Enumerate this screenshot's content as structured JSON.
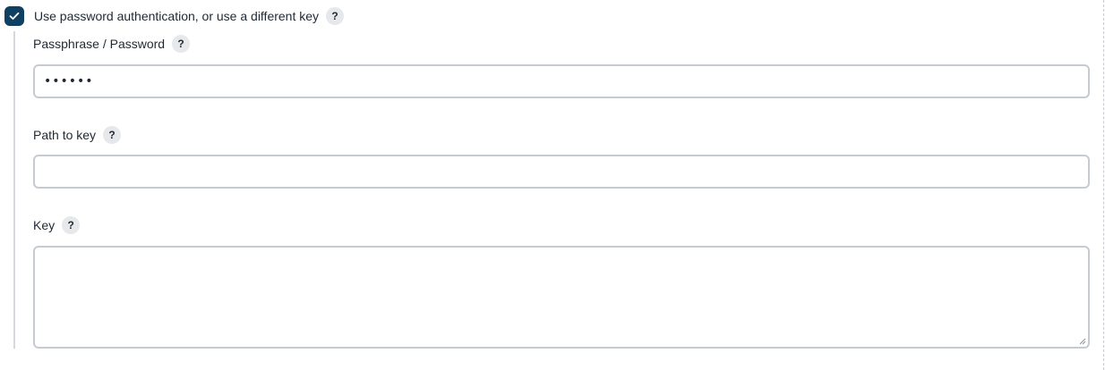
{
  "password_auth": {
    "checked": true,
    "label": "Use password authentication, or use a different key",
    "help_glyph": "?"
  },
  "fields": {
    "passphrase": {
      "label": "Passphrase / Password",
      "value": "••••••",
      "help_glyph": "?"
    },
    "path_to_key": {
      "label": "Path to key",
      "value": "",
      "help_glyph": "?"
    },
    "key": {
      "label": "Key",
      "value": "",
      "help_glyph": "?"
    }
  },
  "colors": {
    "checkbox_fill": "#0f3f61",
    "input_border": "#c5cbd1",
    "help_bg": "#e6e8eb"
  },
  "icons": {
    "checkbox": "checkmark-icon",
    "help": "question-mark-icon",
    "resize": "resize-grip-icon"
  }
}
